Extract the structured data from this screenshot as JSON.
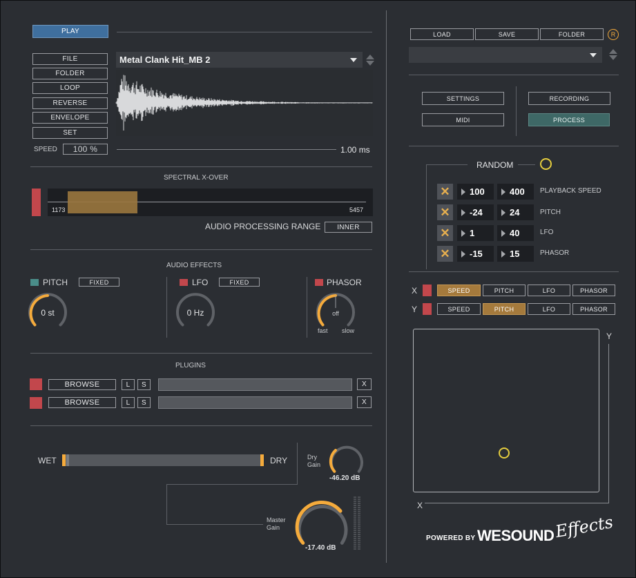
{
  "colors": {
    "accent_orange": "#f5ab3c",
    "accent_blue": "#3f6f9e",
    "accent_teal": "#3e6866",
    "red": "#c2474c",
    "bg": "#2b2e33"
  },
  "player": {
    "play_label": "PLAY",
    "buttons": [
      "FILE",
      "FOLDER",
      "LOOP",
      "REVERSE",
      "ENVELOPE",
      "SET"
    ],
    "speed_label": "SPEED",
    "speed_value": "100 %",
    "file_name": "Metal Clank Hit_MB 2",
    "duration": "1.00 ms"
  },
  "xover": {
    "title": "SPECTRAL X-OVER",
    "low": "1173",
    "high": "5457",
    "range_label": "AUDIO PROCESSING RANGE",
    "range_mode": "INNER"
  },
  "effects": {
    "title": "AUDIO EFFECTS",
    "pitch": {
      "label": "PITCH",
      "mode": "FIXED",
      "value": "0 st"
    },
    "lfo": {
      "label": "LFO",
      "mode": "FIXED",
      "value": "0 Hz"
    },
    "phasor": {
      "label": "PHASOR",
      "value": "off",
      "fast": "fast",
      "slow": "slow"
    }
  },
  "plugins": {
    "title": "PLUGINS",
    "rows": [
      {
        "browse": "BROWSE",
        "l": "L",
        "s": "S",
        "close": "X"
      },
      {
        "browse": "BROWSE",
        "l": "L",
        "s": "S",
        "close": "X"
      }
    ]
  },
  "mix": {
    "wet": "WET",
    "dry": "DRY",
    "dry_gain_label_1": "Dry",
    "dry_gain_label_2": "Gain",
    "dry_gain_value": "-46.20 dB",
    "master_gain_label_1": "Master",
    "master_gain_label_2": "Gain",
    "master_gain_value": "-17.40 dB"
  },
  "presets": {
    "load": "LOAD",
    "save": "SAVE",
    "folder": "FOLDER",
    "r_badge": "R",
    "settings": "SETTINGS",
    "midi": "MIDI",
    "recording": "RECORDING",
    "process": "PROCESS"
  },
  "random": {
    "title": "RANDOM",
    "rows": [
      {
        "min": "100",
        "max": "400",
        "label": "PLAYBACK SPEED"
      },
      {
        "min": "-24",
        "max": "24",
        "label": "PITCH"
      },
      {
        "min": "1",
        "max": "40",
        "label": "LFO"
      },
      {
        "min": "-15",
        "max": "15",
        "label": "PHASOR"
      }
    ]
  },
  "xy": {
    "x_label": "X",
    "y_label": "Y",
    "targets": [
      "SPEED",
      "PITCH",
      "LFO",
      "PHASOR"
    ],
    "x_selected": "SPEED",
    "y_selected": "PITCH",
    "pad_x_label": "X",
    "pad_y_label": "Y"
  },
  "branding": {
    "powered_by": "POWERED BY",
    "brand": "WESOUND",
    "script": "Effects"
  }
}
